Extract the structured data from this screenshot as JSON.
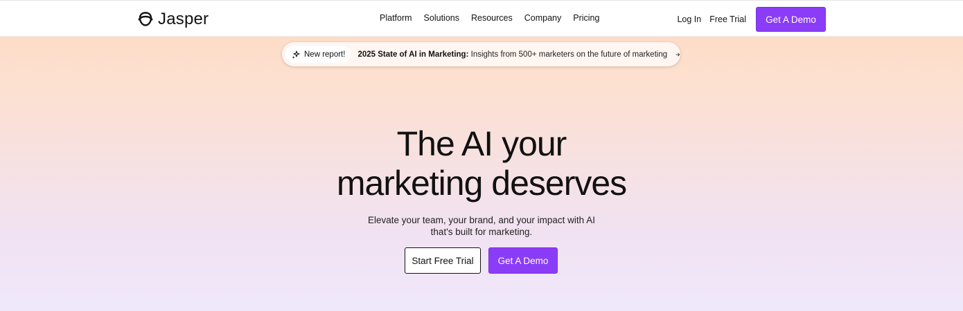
{
  "header": {
    "logo_text": "Jasper",
    "logo_icon": "jasper-face-icon",
    "nav": [
      "Platform",
      "Solutions",
      "Resources",
      "Company",
      "Pricing"
    ],
    "login_label": "Log In",
    "free_trial_label": "Free Trial",
    "demo_label": "Get A Demo"
  },
  "announcement": {
    "badge_label": "New report!",
    "badge_icon": "sparkle-icon",
    "title": "2025 State of AI in Marketing:",
    "text": "Insights from 500+ marketers on the future of marketing",
    "arrow_icon": "arrow-right-icon"
  },
  "hero": {
    "title_line1": "The AI your",
    "title_line2": "marketing deserves",
    "subtitle_line1": "Elevate your team, your brand, and your impact with AI",
    "subtitle_line2": "that's built for marketing.",
    "cta_primary": "Start Free Trial",
    "cta_secondary": "Get A Demo"
  },
  "colors": {
    "accent": "#8b3cf6",
    "text": "#111111"
  }
}
